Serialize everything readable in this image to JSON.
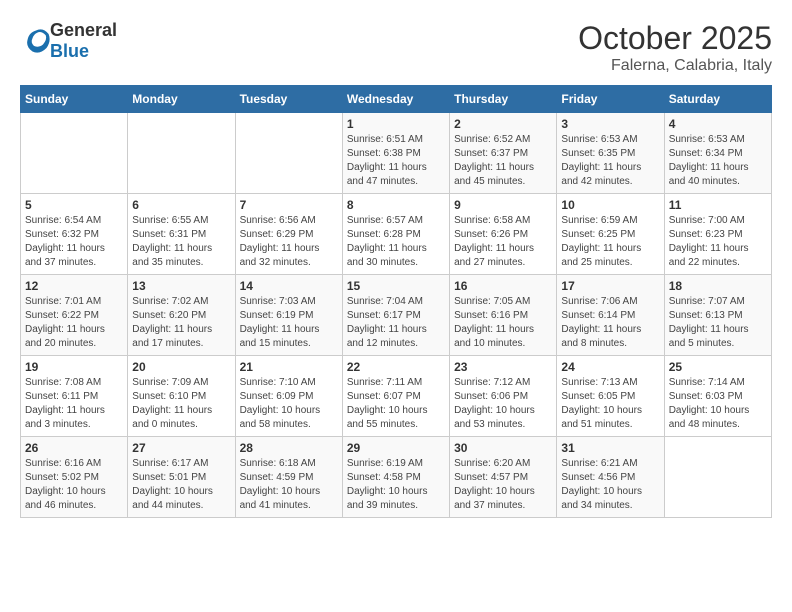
{
  "logo": {
    "general": "General",
    "blue": "Blue"
  },
  "title": "October 2025",
  "subtitle": "Falerna, Calabria, Italy",
  "weekdays": [
    "Sunday",
    "Monday",
    "Tuesday",
    "Wednesday",
    "Thursday",
    "Friday",
    "Saturday"
  ],
  "weeks": [
    [
      {
        "day": "",
        "info": ""
      },
      {
        "day": "",
        "info": ""
      },
      {
        "day": "",
        "info": ""
      },
      {
        "day": "1",
        "info": "Sunrise: 6:51 AM\nSunset: 6:38 PM\nDaylight: 11 hours and 47 minutes."
      },
      {
        "day": "2",
        "info": "Sunrise: 6:52 AM\nSunset: 6:37 PM\nDaylight: 11 hours and 45 minutes."
      },
      {
        "day": "3",
        "info": "Sunrise: 6:53 AM\nSunset: 6:35 PM\nDaylight: 11 hours and 42 minutes."
      },
      {
        "day": "4",
        "info": "Sunrise: 6:53 AM\nSunset: 6:34 PM\nDaylight: 11 hours and 40 minutes."
      }
    ],
    [
      {
        "day": "5",
        "info": "Sunrise: 6:54 AM\nSunset: 6:32 PM\nDaylight: 11 hours and 37 minutes."
      },
      {
        "day": "6",
        "info": "Sunrise: 6:55 AM\nSunset: 6:31 PM\nDaylight: 11 hours and 35 minutes."
      },
      {
        "day": "7",
        "info": "Sunrise: 6:56 AM\nSunset: 6:29 PM\nDaylight: 11 hours and 32 minutes."
      },
      {
        "day": "8",
        "info": "Sunrise: 6:57 AM\nSunset: 6:28 PM\nDaylight: 11 hours and 30 minutes."
      },
      {
        "day": "9",
        "info": "Sunrise: 6:58 AM\nSunset: 6:26 PM\nDaylight: 11 hours and 27 minutes."
      },
      {
        "day": "10",
        "info": "Sunrise: 6:59 AM\nSunset: 6:25 PM\nDaylight: 11 hours and 25 minutes."
      },
      {
        "day": "11",
        "info": "Sunrise: 7:00 AM\nSunset: 6:23 PM\nDaylight: 11 hours and 22 minutes."
      }
    ],
    [
      {
        "day": "12",
        "info": "Sunrise: 7:01 AM\nSunset: 6:22 PM\nDaylight: 11 hours and 20 minutes."
      },
      {
        "day": "13",
        "info": "Sunrise: 7:02 AM\nSunset: 6:20 PM\nDaylight: 11 hours and 17 minutes."
      },
      {
        "day": "14",
        "info": "Sunrise: 7:03 AM\nSunset: 6:19 PM\nDaylight: 11 hours and 15 minutes."
      },
      {
        "day": "15",
        "info": "Sunrise: 7:04 AM\nSunset: 6:17 PM\nDaylight: 11 hours and 12 minutes."
      },
      {
        "day": "16",
        "info": "Sunrise: 7:05 AM\nSunset: 6:16 PM\nDaylight: 11 hours and 10 minutes."
      },
      {
        "day": "17",
        "info": "Sunrise: 7:06 AM\nSunset: 6:14 PM\nDaylight: 11 hours and 8 minutes."
      },
      {
        "day": "18",
        "info": "Sunrise: 7:07 AM\nSunset: 6:13 PM\nDaylight: 11 hours and 5 minutes."
      }
    ],
    [
      {
        "day": "19",
        "info": "Sunrise: 7:08 AM\nSunset: 6:11 PM\nDaylight: 11 hours and 3 minutes."
      },
      {
        "day": "20",
        "info": "Sunrise: 7:09 AM\nSunset: 6:10 PM\nDaylight: 11 hours and 0 minutes."
      },
      {
        "day": "21",
        "info": "Sunrise: 7:10 AM\nSunset: 6:09 PM\nDaylight: 10 hours and 58 minutes."
      },
      {
        "day": "22",
        "info": "Sunrise: 7:11 AM\nSunset: 6:07 PM\nDaylight: 10 hours and 55 minutes."
      },
      {
        "day": "23",
        "info": "Sunrise: 7:12 AM\nSunset: 6:06 PM\nDaylight: 10 hours and 53 minutes."
      },
      {
        "day": "24",
        "info": "Sunrise: 7:13 AM\nSunset: 6:05 PM\nDaylight: 10 hours and 51 minutes."
      },
      {
        "day": "25",
        "info": "Sunrise: 7:14 AM\nSunset: 6:03 PM\nDaylight: 10 hours and 48 minutes."
      }
    ],
    [
      {
        "day": "26",
        "info": "Sunrise: 6:16 AM\nSunset: 5:02 PM\nDaylight: 10 hours and 46 minutes."
      },
      {
        "day": "27",
        "info": "Sunrise: 6:17 AM\nSunset: 5:01 PM\nDaylight: 10 hours and 44 minutes."
      },
      {
        "day": "28",
        "info": "Sunrise: 6:18 AM\nSunset: 4:59 PM\nDaylight: 10 hours and 41 minutes."
      },
      {
        "day": "29",
        "info": "Sunrise: 6:19 AM\nSunset: 4:58 PM\nDaylight: 10 hours and 39 minutes."
      },
      {
        "day": "30",
        "info": "Sunrise: 6:20 AM\nSunset: 4:57 PM\nDaylight: 10 hours and 37 minutes."
      },
      {
        "day": "31",
        "info": "Sunrise: 6:21 AM\nSunset: 4:56 PM\nDaylight: 10 hours and 34 minutes."
      },
      {
        "day": "",
        "info": ""
      }
    ]
  ]
}
